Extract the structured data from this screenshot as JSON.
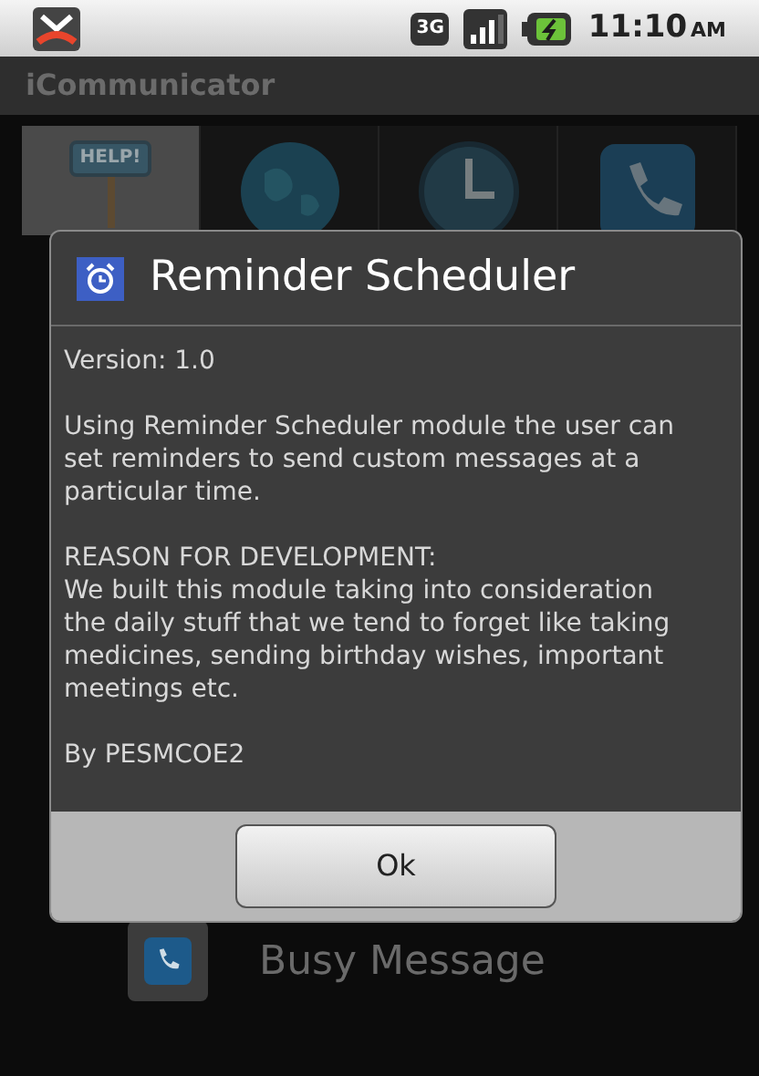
{
  "status_bar": {
    "time": "11:10",
    "time_suffix": "AM",
    "network": "3G"
  },
  "app_bar": {
    "title": "iCommunicator"
  },
  "tabs": [
    {
      "kind": "help",
      "label": "HELP!",
      "selected": true
    },
    {
      "kind": "globe",
      "selected": false
    },
    {
      "kind": "clock",
      "selected": false
    },
    {
      "kind": "phone",
      "selected": false
    }
  ],
  "list": [
    {
      "kind": "phone",
      "label": "Busy Message"
    }
  ],
  "dialog": {
    "title": "Reminder Scheduler",
    "paragraphs": [
      "Version: 1.0",
      "Using Reminder Scheduler module the user can set reminders to send custom messages at a particular time.",
      "REASON FOR DEVELOPMENT:\nWe built this module taking into consideration the daily stuff that we tend to forget like taking medicines, sending birthday wishes, important meetings etc.",
      "By PESMCOE2"
    ],
    "button": "Ok"
  }
}
